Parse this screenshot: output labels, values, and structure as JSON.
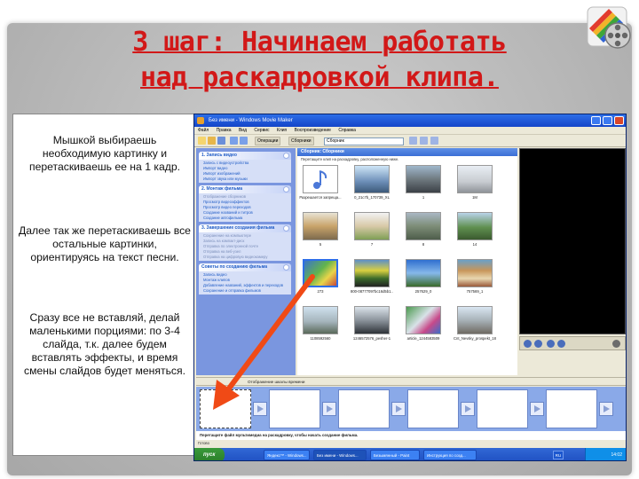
{
  "slide": {
    "title_line1": "3 шаг: Начинаем работать",
    "title_line2": "над раскадровкой клипа."
  },
  "instructions": {
    "para1": "Мышкой выбираешь необходимую картинку и перетаскиваешь ее на 1 кадр.",
    "para2": "Далее так же перетаскиваешь все остальные картинки, ориентируясь на текст песни.",
    "para3": "Сразу все не вставляй, делай маленькими порциями: по 3-4 слайда, т.к. далее будем вставлять эффекты, и время смены слайдов будет меняться."
  },
  "app": {
    "window_title": "Без имени - Windows Movie Maker",
    "menu": [
      "Файл",
      "Правка",
      "Вид",
      "Сервис",
      "Клип",
      "Воспроизведение",
      "Справка"
    ],
    "toolbar": {
      "tasks_label": "Операции",
      "collections_label": "Сборники",
      "collection_select": "Сборник"
    },
    "task_pane": {
      "section1": {
        "title": "1. Запись видео",
        "items": [
          "Запись с видеоустройства",
          "Импорт видео",
          "Импорт изображений",
          "Импорт звука или музыки"
        ]
      },
      "section2": {
        "title": "2. Монтаж фильма",
        "items": [
          "Отображение сборников",
          "Просмотр видеоэффектов",
          "Просмотр видео переходов",
          "Создание названий и титров",
          "Создание автофильма"
        ]
      },
      "section3": {
        "title": "3. Завершение создания фильма",
        "items": [
          "Сохранение на компьютере",
          "Запись на компакт-диск",
          "Отправка по электронной почте",
          "Отправка на веб-узел",
          "Отправка на цифровую видеокамеру"
        ]
      },
      "section4": {
        "title": "Советы по созданию фильма",
        "items": [
          "Запись видео",
          "Монтаж клипов",
          "Добавление названий, эффектов и переходов",
          "Сохранение и отправка фильмов"
        ]
      }
    },
    "collection": {
      "title": "Сборник: Сборники",
      "hint": "Перетащите клип на раскадровку, расположенную ниже.",
      "clips": [
        "Разрешается запреща...",
        "0_21c7b_170739_XL",
        "1",
        "1M",
        "5",
        "7",
        "8",
        "14",
        "273",
        "800-08777097bc16d5b1...",
        "257629_0",
        "757569_1",
        "1108592560",
        "1246572576_pesher-1",
        "article_1244583509",
        "Cnt_Nevsky_prospekt_18-1_8-2004"
      ]
    },
    "storyboard": {
      "timeline_label": "Отображение шкалы времени",
      "hint": "Перетащите файл мультимедиа на раскадровку, чтобы начать создание фильма."
    },
    "status": "Готово",
    "taskbar": {
      "start": "пуск",
      "tasks": [
        "Яндекс™ - Windows...",
        "Без имени - Windows...",
        "Безымянный - Paint",
        "Инструкция по созд..."
      ],
      "lang": "RU",
      "time": "14:02"
    }
  },
  "colors": {
    "title_red": "#d21818",
    "arrow_orange": "#f04a16",
    "xp_blue": "#2d6ee8"
  },
  "icons": {
    "logo": "film-reel-icon",
    "arrow": "drag-arrow"
  }
}
